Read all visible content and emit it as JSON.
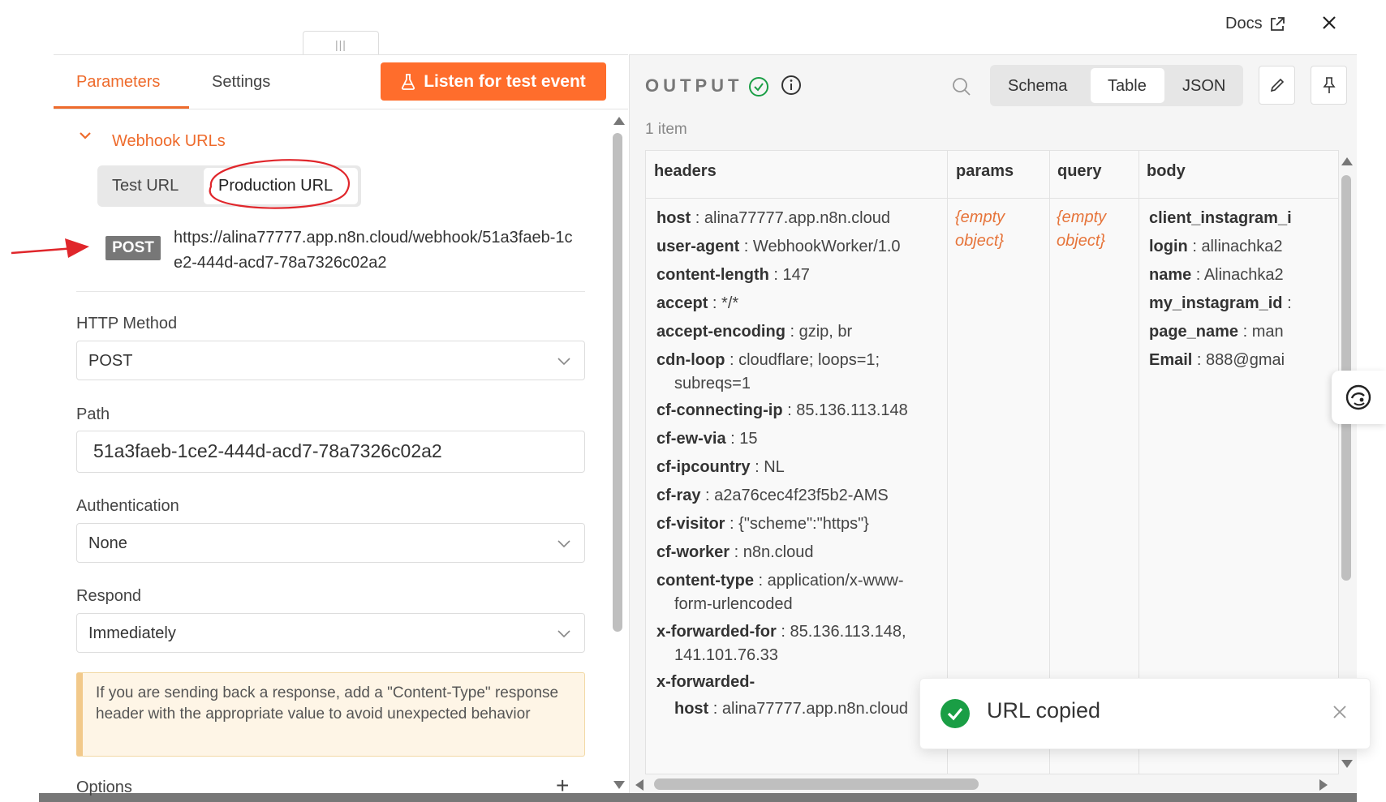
{
  "header": {
    "docs_label": "Docs",
    "close_icon": "close-icon",
    "drag_handle": "|||"
  },
  "left": {
    "tabs": [
      "Parameters",
      "Settings"
    ],
    "listen_button": "Listen for test event",
    "webhook_section_title": "Webhook URLs",
    "url_toggle": [
      "Test URL",
      "Production URL"
    ],
    "method_badge": "POST",
    "webhook_url": "https://alina77777.app.n8n.cloud/webhook/51a3faeb-1ce2-444d-acd7-78a7326c02a2",
    "http_method": {
      "label": "HTTP Method",
      "value": "POST"
    },
    "path": {
      "label": "Path",
      "value": "51a3faeb-1ce2-444d-acd7-78a7326c02a2"
    },
    "authentication": {
      "label": "Authentication",
      "value": "None"
    },
    "respond": {
      "label": "Respond",
      "value": "Immediately"
    },
    "note": "If you are sending back a response, add a \"Content-Type\" response header with the appropriate value to avoid unexpected behavior",
    "options_label": "Options",
    "options_add": "+"
  },
  "output": {
    "title": "OUTPUT",
    "view_modes": [
      "Schema",
      "Table",
      "JSON"
    ],
    "active_view": "Table",
    "item_count": "1 item",
    "columns": [
      "headers",
      "params",
      "query",
      "body"
    ],
    "headers": [
      {
        "key": "host",
        "value": "alina77777.app.n8n.cloud"
      },
      {
        "key": "user-agent",
        "value": "WebhookWorker/1.0"
      },
      {
        "key": "content-length",
        "value": "147"
      },
      {
        "key": "accept",
        "value": "*/*"
      },
      {
        "key": "accept-encoding",
        "value": "gzip, br"
      },
      {
        "key": "cdn-loop",
        "value": "cloudflare; loops=1;",
        "cont": "subreqs=1"
      },
      {
        "key": "cf-connecting-ip",
        "value": "85.136.113.148"
      },
      {
        "key": "cf-ew-via",
        "value": "15"
      },
      {
        "key": "cf-ipcountry",
        "value": "NL"
      },
      {
        "key": "cf-ray",
        "value": "a2a76cec4f23f5b2-AMS"
      },
      {
        "key": "cf-visitor",
        "value": "{\"scheme\":\"https\"}"
      },
      {
        "key": "cf-worker",
        "value": "n8n.cloud"
      },
      {
        "key": "content-type",
        "value": "application/x-www-",
        "cont": "form-urlencoded"
      },
      {
        "key": "x-forwarded-for",
        "value": "85.136.113.148,",
        "cont": "141.101.76.33"
      },
      {
        "key": "x-forwarded-",
        "value": "",
        "cont_key": "host",
        "cont": "alina77777.app.n8n.cloud"
      }
    ],
    "params_value": "{empty object}",
    "query_value": "{empty object}",
    "body": [
      {
        "key": "client_instagram_i",
        "value": ""
      },
      {
        "key": "login",
        "value": "allinachka2"
      },
      {
        "key": "name",
        "value": "Alinachka2"
      },
      {
        "key": "my_instagram_id",
        "value": ""
      },
      {
        "key": "page_name",
        "value": "man"
      },
      {
        "key": "Email",
        "value": "888@gmai"
      }
    ]
  },
  "toast": {
    "message": "URL copied"
  },
  "colors": {
    "accent": "#ff6d2c",
    "accent_text": "#ee6b2c",
    "success": "#1a9e45",
    "annotation": "#e0262b"
  }
}
